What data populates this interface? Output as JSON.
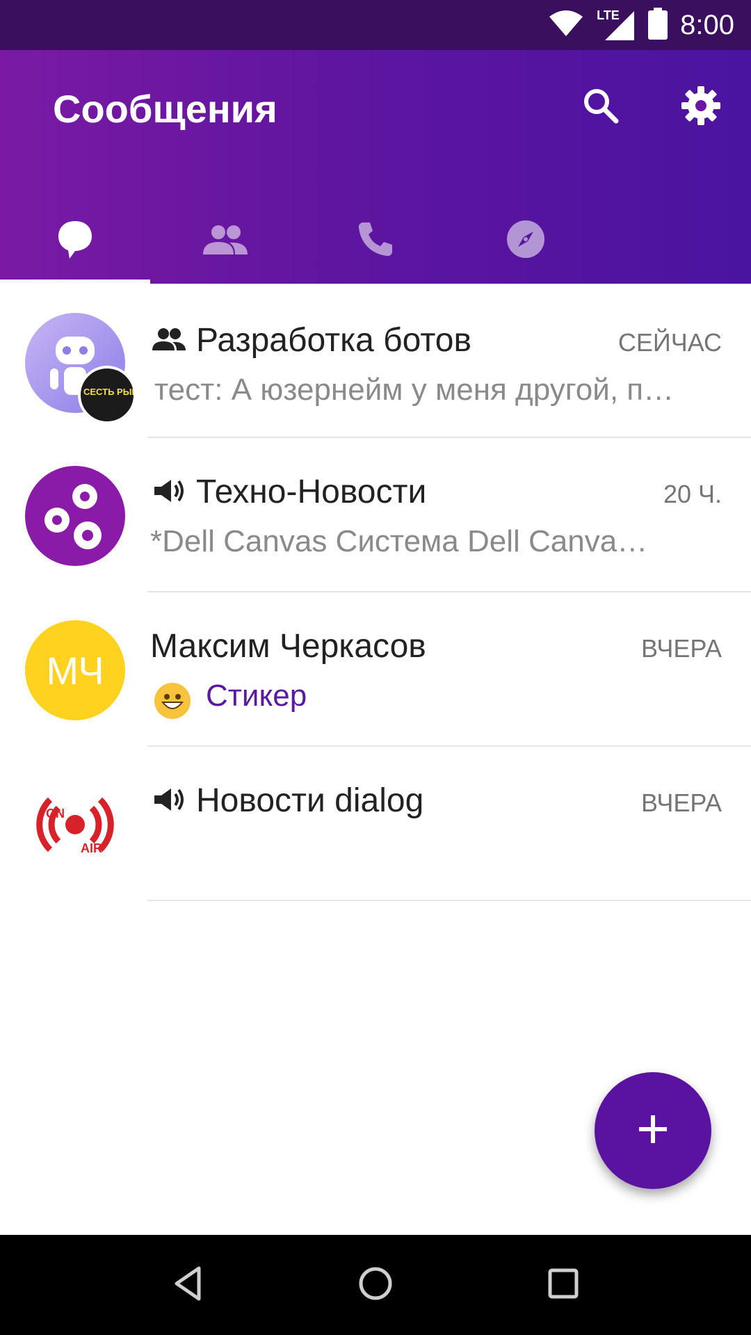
{
  "status_bar": {
    "time": "8:00",
    "network": "LTE"
  },
  "app_bar": {
    "title": "Сообщения",
    "icons": [
      "search-icon",
      "gear-icon"
    ]
  },
  "tabs": [
    {
      "name": "chats",
      "icon": "chat-bubble-icon",
      "active": true
    },
    {
      "name": "contacts",
      "icon": "people-icon",
      "active": false
    },
    {
      "name": "calls",
      "icon": "phone-icon",
      "active": false
    },
    {
      "name": "discover",
      "icon": "compass-icon",
      "active": false
    }
  ],
  "chats": [
    {
      "name": "Разработка ботов",
      "type": "group",
      "time": "СЕЙЧАС",
      "preview": "тест: А юзернейм у меня другой, п…",
      "badge_text": "СЕСТЬ РЫБА"
    },
    {
      "name": "Техно-Новости",
      "type": "channel",
      "time": "20 Ч.",
      "preview": "*Dell Canvas Система Dell Canva…"
    },
    {
      "name": "Максим Черкасов",
      "type": "user",
      "time": "ВЧЕРА",
      "preview": "Стикер",
      "avatar_initials": "МЧ"
    },
    {
      "name": "Новости dialog",
      "type": "channel",
      "time": "ВЧЕРА",
      "preview": "",
      "logo_text_top": "ON",
      "logo_text_bottom": "AIR"
    }
  ],
  "fab": {
    "icon": "plus-icon"
  },
  "nav": {
    "icons": [
      "back-icon",
      "home-icon",
      "recents-icon"
    ]
  },
  "colors": {
    "status_bar": "#3a0f5e",
    "app_bar_start": "#7a1aa4",
    "app_bar_end": "#4a14a0",
    "accent": "#5a12a0",
    "sticker_text": "#5a1aa0"
  }
}
